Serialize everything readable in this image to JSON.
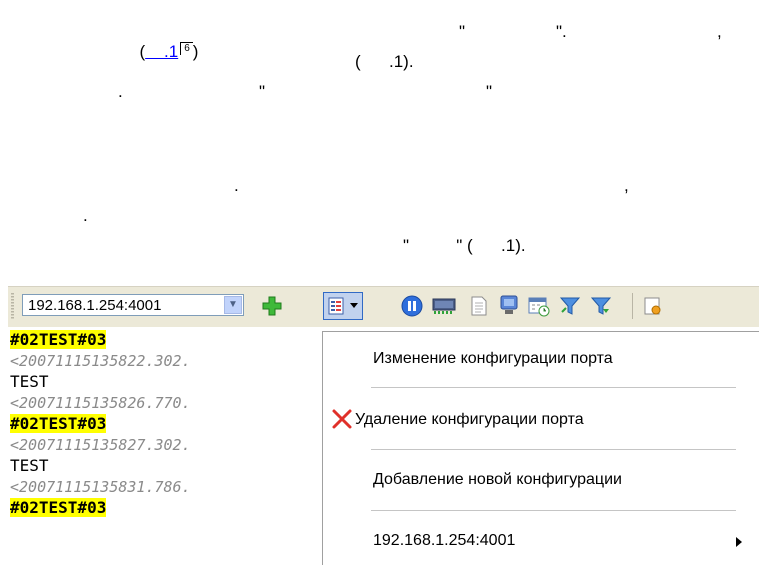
{
  "doc": {
    "line1_open": "(",
    "line1_link": "    .1",
    "line1_sup": "6",
    "line1_close": ")",
    "line1_q1": "\"",
    "line1_q2": "\".",
    "line1_comma": ",",
    "line2": "(      .1).",
    "line3_dot": ".",
    "line3_q1": "\"",
    "line3_q2": "\"",
    "line4_dot": ".",
    "line4_comma": ",",
    "line5_dot": ".",
    "line6": "\"          \" (      .1)."
  },
  "toolbar": {
    "address": "192.168.1.254:4001",
    "icons": [
      "dropdown-arrow-icon",
      "add-plus-icon",
      "config-menu-icon",
      "pause-icon",
      "port-icon",
      "document-icon",
      "terminal-icon",
      "schedule-icon",
      "filter-icon",
      "filter-arrow-icon",
      "settings-icon"
    ]
  },
  "log": {
    "lines": [
      {
        "text": "#02TEST#03",
        "kind": "highlight"
      },
      {
        "text": "<20071115135822.302.",
        "kind": "timestamp"
      },
      {
        "text": "TEST",
        "kind": "plain"
      },
      {
        "text": "<20071115135826.770.",
        "kind": "timestamp"
      },
      {
        "text": "#02TEST#03",
        "kind": "highlight"
      },
      {
        "text": "<20071115135827.302.",
        "kind": "timestamp"
      },
      {
        "text": "TEST",
        "kind": "plain"
      },
      {
        "text": "<20071115135831.786.",
        "kind": "timestamp"
      },
      {
        "text": "#02TEST#03",
        "kind": "highlight"
      }
    ]
  },
  "menu": {
    "items": [
      {
        "label": "Изменение конфигурации порта"
      },
      {
        "label": "Удаление конфигурации порта",
        "icon": "delete-x-icon"
      },
      {
        "label": "Добавление новой конфигурации"
      },
      {
        "label": "192.168.1.254:4001",
        "submenu": true
      }
    ]
  },
  "colors": {
    "highlight": "#ffff00",
    "link": "#0000ff",
    "delete": "#e0302a",
    "toolbar": "#ece9d8"
  }
}
